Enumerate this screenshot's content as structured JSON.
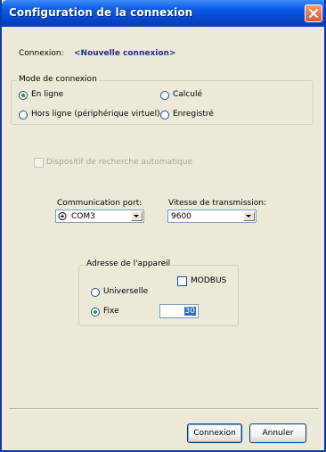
{
  "window": {
    "title": "Configuration de la connexion"
  },
  "connection": {
    "label": "Connexion:",
    "name": "<Nouvelle connexion>"
  },
  "mode_group": {
    "legend": "Mode de connexion",
    "options": [
      {
        "label": "En ligne",
        "selected": true
      },
      {
        "label": "Calculé",
        "selected": false
      },
      {
        "label": "Hors ligne (périphérique virtuel)",
        "selected": false
      },
      {
        "label": "Enregistré",
        "selected": false
      }
    ]
  },
  "auto_search": {
    "label": "Dispositif de recherche automatique",
    "checked": false,
    "enabled": false
  },
  "port": {
    "label": "Communication port:",
    "value": "COM3",
    "icon": "com-port-icon"
  },
  "baud": {
    "label": "Vitesse de transmission:",
    "value": "9600"
  },
  "address_group": {
    "legend": "Adresse de l'appareil",
    "modbus_label": "MODBUS",
    "modbus_checked": false,
    "universal_label": "Universelle",
    "universal_selected": false,
    "fixed_label": "Fixe",
    "fixed_selected": true,
    "fixed_value": "30"
  },
  "buttons": {
    "connect": "Connexion",
    "cancel": "Annuler"
  },
  "colors": {
    "title_bar": "#0a5ae6",
    "connection_name": "#1c2f86",
    "close_button": "#e0542c",
    "radio_dot": "#21a121",
    "selection": "#316ac5"
  }
}
